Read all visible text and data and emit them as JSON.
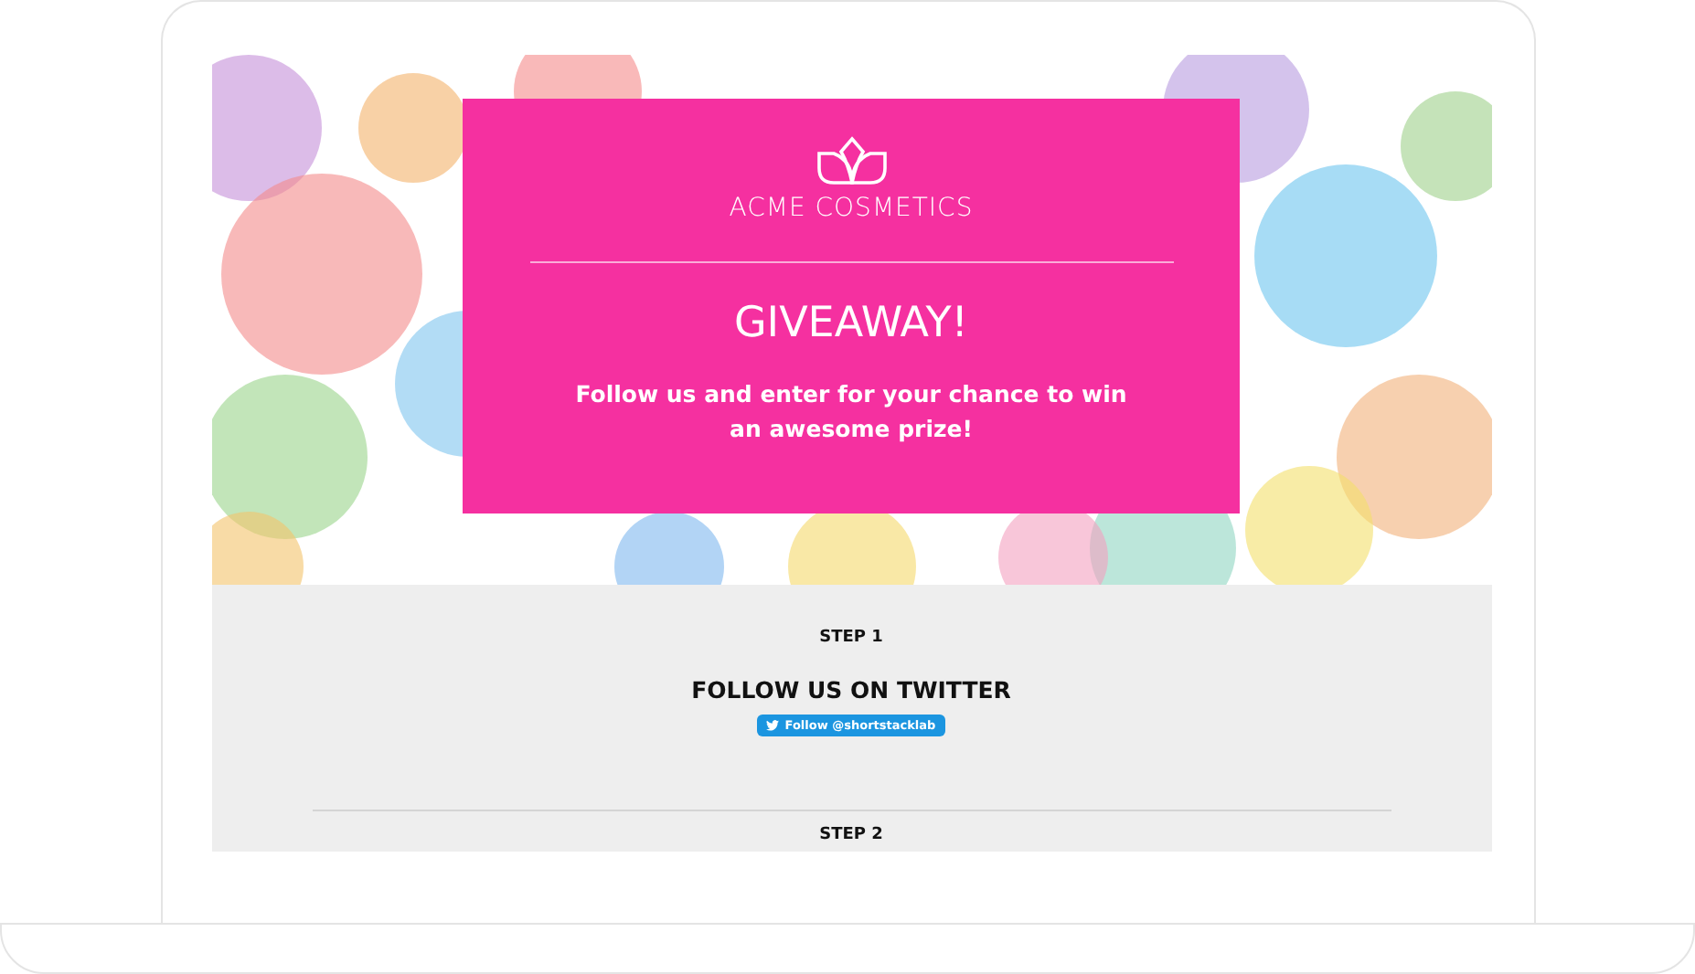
{
  "hero": {
    "brand": "ACME COSMETICS",
    "title": "GIVEAWAY!",
    "subtitle": "Follow us and enter for your chance to win an awesome prize!"
  },
  "steps": [
    {
      "step": "STEP 1",
      "heading": "FOLLOW US ON TWITTER",
      "button": "Follow @shortstacklab"
    },
    {
      "step": "STEP 2"
    }
  ]
}
